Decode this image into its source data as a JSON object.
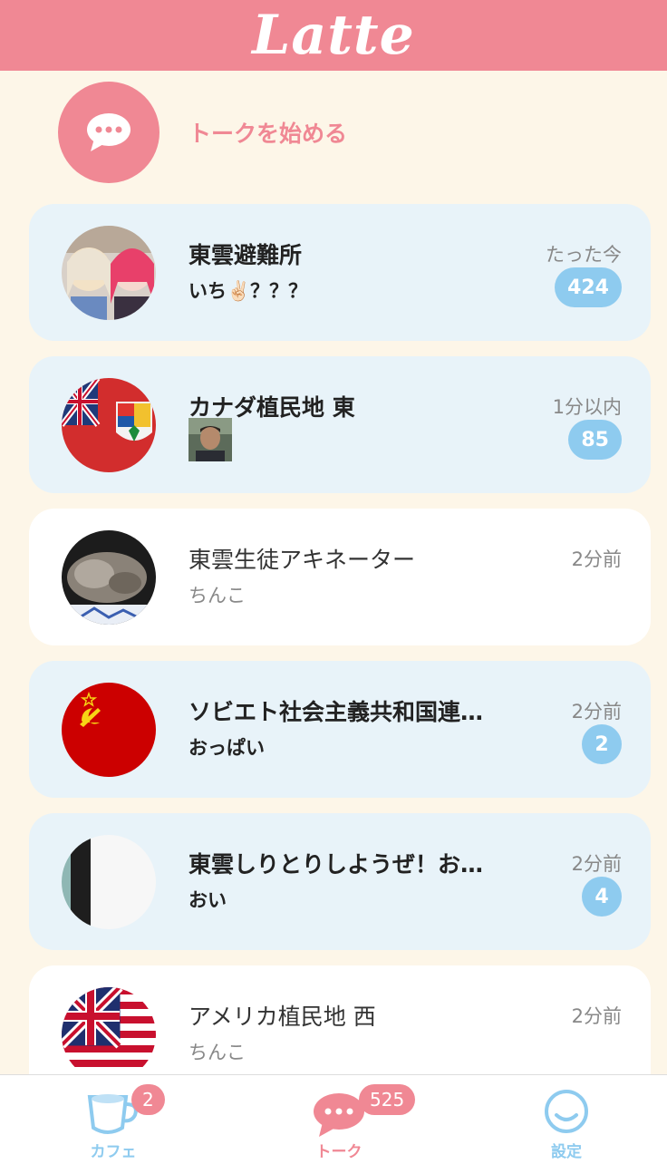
{
  "header": {
    "logo": "Latte"
  },
  "start_talk": {
    "label": "トークを始める"
  },
  "chats": [
    {
      "title": "東雲避難所",
      "preview": "いち✌🏻？？？",
      "time": "たった今",
      "badge": "424",
      "unread": true,
      "avatar": "anime-girls-avatar"
    },
    {
      "title": "カナダ植民地 東",
      "preview": "",
      "time": "1分以内",
      "badge": "85",
      "unread": true,
      "avatar": "canada-red-ensign-avatar",
      "has_image": true
    },
    {
      "title": "東雲生徒アキネーター",
      "preview": "ちんこ",
      "time": "2分前",
      "badge": "",
      "unread": false,
      "avatar": "cat-photo-avatar"
    },
    {
      "title": "ソビエト社会主義共和国連…",
      "preview": "おっぱい",
      "time": "2分前",
      "badge": "2",
      "unread": true,
      "avatar": "soviet-flag-avatar"
    },
    {
      "title": "東雲しりとりしようぜ！お…",
      "preview": "おい",
      "time": "2分前",
      "badge": "4",
      "unread": true,
      "avatar": "white-black-avatar"
    },
    {
      "title": "アメリカ植民地 西",
      "preview": "ちんこ",
      "time": "2分前",
      "badge": "",
      "unread": false,
      "avatar": "grand-union-flag-avatar"
    }
  ],
  "tabs": {
    "cafe": {
      "label": "カフェ",
      "badge": "2"
    },
    "talk": {
      "label": "トーク",
      "badge": "525"
    },
    "settings": {
      "label": "設定"
    }
  },
  "colors": {
    "accent": "#f08894",
    "badge_blue": "#8ecbef",
    "unread_card": "#e8f3f9",
    "background": "#fdf6e8"
  }
}
